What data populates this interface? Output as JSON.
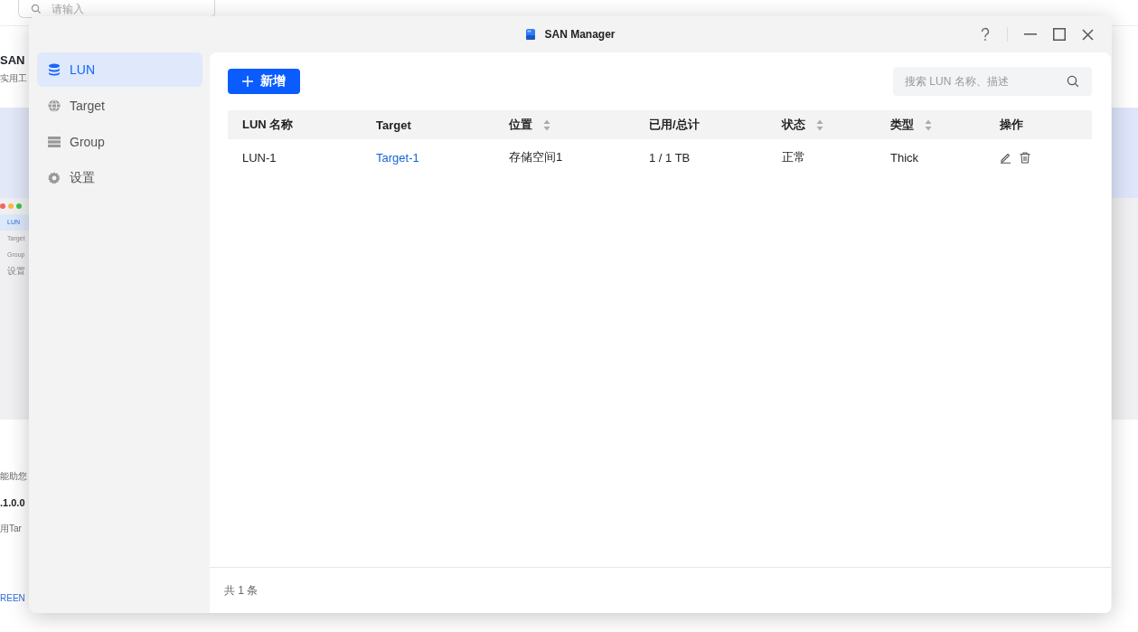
{
  "background": {
    "search": {
      "placeholder": "请输入"
    },
    "app_title": "SAN",
    "app_subtitle": "实用工",
    "mini_window": {
      "items": [
        {
          "label": "LUN",
          "selected": true
        },
        {
          "label": "Target",
          "selected": false
        },
        {
          "label": "Group",
          "selected": false
        },
        {
          "label": "设置",
          "selected": false
        }
      ]
    },
    "texts": [
      {
        "kind": "plain",
        "text": "能助您"
      },
      {
        "kind": "bold",
        "text": ".1.0.0"
      },
      {
        "kind": "plain",
        "text": "用Tar"
      },
      {
        "kind": "link",
        "text": "REEN"
      }
    ]
  },
  "window": {
    "title": "SAN Manager",
    "sidebar": {
      "items": [
        {
          "label": "LUN",
          "selected": true
        },
        {
          "label": "Target",
          "selected": false
        },
        {
          "label": "Group",
          "selected": false
        },
        {
          "label": "设置",
          "selected": false
        }
      ]
    },
    "add_button": "新增",
    "search": {
      "placeholder": "搜索 LUN 名称、描述"
    },
    "table": {
      "columns": [
        {
          "label": "LUN 名称",
          "sortable": false
        },
        {
          "label": "Target",
          "sortable": false
        },
        {
          "label": "位置",
          "sortable": true
        },
        {
          "label": "已用/总计",
          "sortable": false
        },
        {
          "label": "状态",
          "sortable": true
        },
        {
          "label": "类型",
          "sortable": true
        },
        {
          "label": "操作",
          "sortable": false
        }
      ],
      "rows": [
        {
          "cells": [
            {
              "kind": "text",
              "text": "LUN-1"
            },
            {
              "kind": "link",
              "text": "Target-1"
            },
            {
              "kind": "text",
              "text": "存储空间1"
            },
            {
              "kind": "text",
              "text": "1 / 1 TB"
            },
            {
              "kind": "text",
              "text": "正常"
            },
            {
              "kind": "text",
              "text": "Thick"
            },
            {
              "kind": "actions"
            }
          ]
        }
      ]
    },
    "footer": "共 1 条"
  }
}
